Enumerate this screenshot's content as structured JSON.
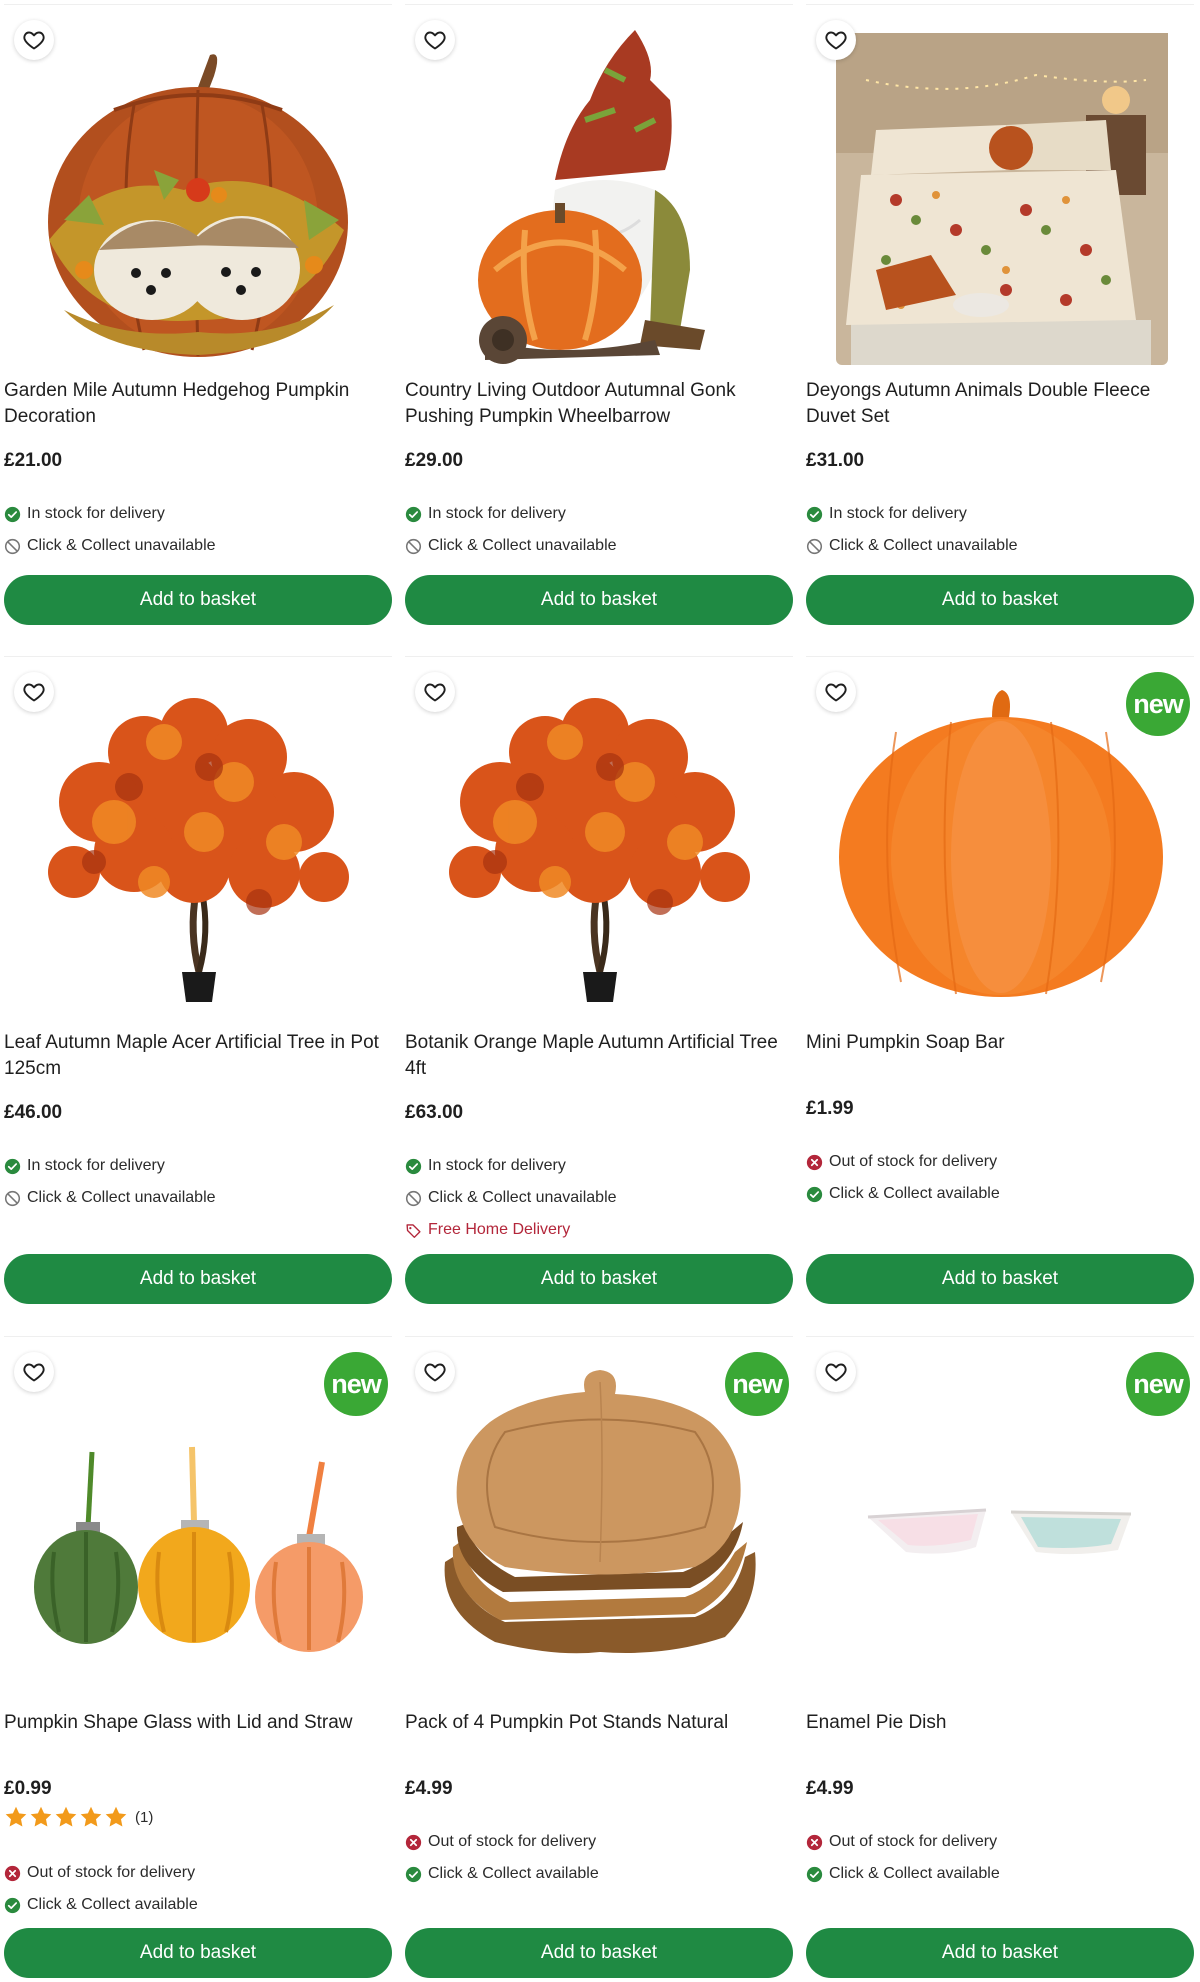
{
  "products": [
    {
      "title": "Garden Mile Autumn Hedgehog Pumpkin Decoration",
      "price": "£21.00",
      "delivery": "In stock for delivery",
      "collect": "Click & Collect unavailable",
      "button": "Add to basket"
    },
    {
      "title": "Country Living Outdoor Autumnal Gonk Pushing Pumpkin Wheelbarrow",
      "price": "£29.00",
      "delivery": "In stock for delivery",
      "collect": "Click & Collect unavailable",
      "button": "Add to basket"
    },
    {
      "title": "Deyongs Autumn Animals Double Fleece Duvet Set",
      "price": "£31.00",
      "delivery": "In stock for delivery",
      "collect": "Click & Collect unavailable",
      "button": "Add to basket"
    },
    {
      "title": "Leaf Autumn Maple Acer Artificial Tree in Pot 125cm",
      "price": "£46.00",
      "delivery": "In stock for delivery",
      "collect": "Click & Collect unavailable",
      "button": "Add to basket"
    },
    {
      "title": "Botanik Orange Maple Autumn Artificial Tree 4ft",
      "price": "£63.00",
      "delivery": "In stock for delivery",
      "collect": "Click & Collect unavailable",
      "promo": "Free Home Delivery",
      "button": "Add to basket"
    },
    {
      "title": "Mini Pumpkin Soap Bar",
      "price": "£1.99",
      "badge": "new",
      "delivery": "Out of stock for delivery",
      "collect": "Click & Collect available",
      "button": "Add to basket"
    },
    {
      "title": "Pumpkin Shape Glass with Lid and Straw",
      "price": "£0.99",
      "badge": "new",
      "rating": 5,
      "rating_count": "(1)",
      "delivery": "Out of stock for delivery",
      "collect": "Click & Collect available",
      "button": "Add to basket"
    },
    {
      "title": "Pack of 4 Pumpkin Pot Stands Natural",
      "price": "£4.99",
      "badge": "new",
      "delivery": "Out of stock for delivery",
      "collect": "Click & Collect available",
      "button": "Add to basket"
    },
    {
      "title": "Enamel Pie Dish",
      "price": "£4.99",
      "badge": "new",
      "delivery": "Out of stock for delivery",
      "collect": "Click & Collect available",
      "button": "Add to basket"
    }
  ],
  "icons": {
    "wishlist": "heart-outline-icon",
    "available": "check-circle-icon",
    "unavailable": "prohibited-icon",
    "out_of_stock": "x-circle-icon",
    "promo": "tag-icon",
    "rating": "star-icon"
  },
  "colors": {
    "button": "#1f8a43",
    "in_stock": "#2a8a3e",
    "out_of_stock": "#b3263a",
    "new_badge": "#3aa835",
    "promo": "#b3263a",
    "star": "#f29a1b"
  }
}
